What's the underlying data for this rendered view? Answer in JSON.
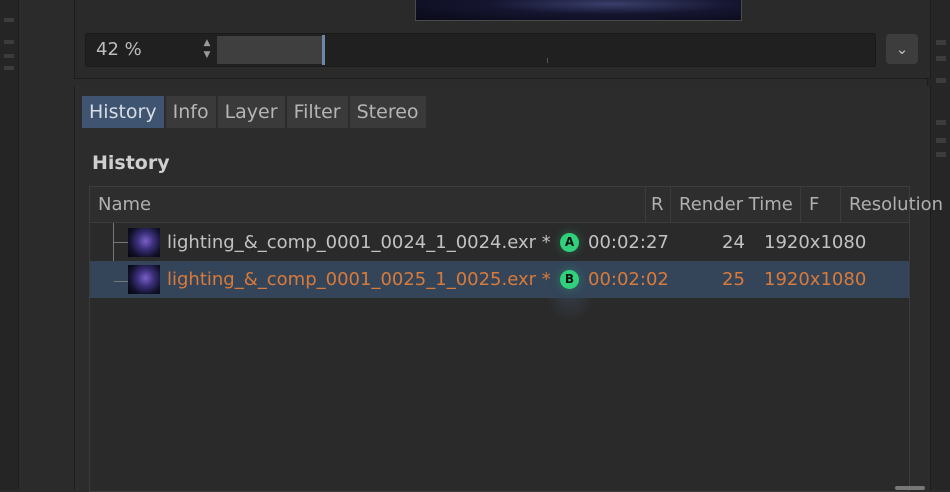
{
  "zoom": {
    "value": "42 %",
    "level_fraction": 0.16
  },
  "tabs": [
    {
      "label": "History",
      "active": true
    },
    {
      "label": "Info",
      "active": false
    },
    {
      "label": "Layer",
      "active": false
    },
    {
      "label": "Filter",
      "active": false
    },
    {
      "label": "Stereo",
      "active": false
    }
  ],
  "section_title": "History",
  "table": {
    "columns": [
      "Name",
      "R",
      "Render Time",
      "F",
      "Resolution"
    ],
    "rows": [
      {
        "name": "lighting_&_comp_0001_0024_1_0024.exr *",
        "r": "A",
        "render_time": "00:02:27",
        "frame": "24",
        "resolution": "1920x1080",
        "selected": false
      },
      {
        "name": "lighting_&_comp_0001_0025_1_0025.exr *",
        "r": "B",
        "render_time": "00:02:02",
        "frame": "25",
        "resolution": "1920x1080",
        "selected": true
      }
    ]
  },
  "icons": {
    "spin": "up-down-arrows-icon",
    "dropdown": "chevron-down-icon",
    "badge_a": "badge-a-icon",
    "badge_b": "badge-b-icon",
    "thumbnail": "render-thumbnail-icon"
  },
  "colors": {
    "tab_active": "#3f5470",
    "selected_row": "#344559",
    "selected_text": "#d97a3a",
    "badge": "#2fd17c"
  }
}
